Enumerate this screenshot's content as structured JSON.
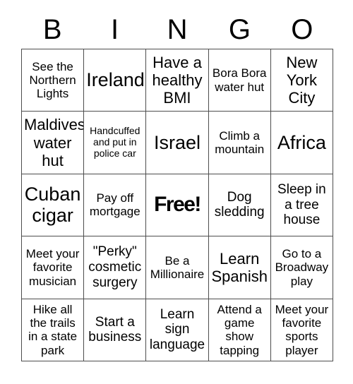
{
  "card": {
    "title": "BINGO Card",
    "header_letters": [
      "B",
      "I",
      "N",
      "G",
      "O"
    ],
    "columns": 5,
    "rows": 5,
    "free_space_label": "Free!",
    "colors": {
      "background": "#ffffff",
      "text": "#000000",
      "border": "#4d4d4d"
    },
    "cells": [
      {
        "text": "See the Northern Lights",
        "size": "s",
        "free": false
      },
      {
        "text": "Ireland",
        "size": "xl",
        "free": false
      },
      {
        "text": "Have a healthy BMI",
        "size": "l",
        "free": false
      },
      {
        "text": "Bora Bora water hut",
        "size": "s",
        "free": false
      },
      {
        "text": "New York City",
        "size": "l",
        "free": false
      },
      {
        "text": "Maldives water hut",
        "size": "l",
        "free": false
      },
      {
        "text": "Handcuffed and put in police car",
        "size": "xs",
        "free": false
      },
      {
        "text": "Israel",
        "size": "xl",
        "free": false
      },
      {
        "text": "Climb a mountain",
        "size": "s",
        "free": false
      },
      {
        "text": "Africa",
        "size": "xl",
        "free": false
      },
      {
        "text": "Cuban cigar",
        "size": "xl",
        "free": false
      },
      {
        "text": "Pay off mortgage",
        "size": "s",
        "free": false
      },
      {
        "text": "Free!",
        "size": "xl",
        "free": true
      },
      {
        "text": "Dog sledding",
        "size": "m",
        "free": false
      },
      {
        "text": "Sleep in a tree house",
        "size": "m",
        "free": false
      },
      {
        "text": "Meet your favorite musician",
        "size": "s",
        "free": false
      },
      {
        "text": "\"Perky\" cosmetic surgery",
        "size": "m",
        "free": false
      },
      {
        "text": "Be a Millionaire",
        "size": "s",
        "free": false
      },
      {
        "text": "Learn Spanish",
        "size": "l",
        "free": false
      },
      {
        "text": "Go to a Broadway play",
        "size": "s",
        "free": false
      },
      {
        "text": "Hike all the trails in a state park",
        "size": "s",
        "free": false
      },
      {
        "text": "Start a business",
        "size": "m",
        "free": false
      },
      {
        "text": "Learn sign language",
        "size": "m",
        "free": false
      },
      {
        "text": "Attend a game show tapping",
        "size": "s",
        "free": false
      },
      {
        "text": "Meet your favorite sports player",
        "size": "s",
        "free": false
      }
    ]
  }
}
